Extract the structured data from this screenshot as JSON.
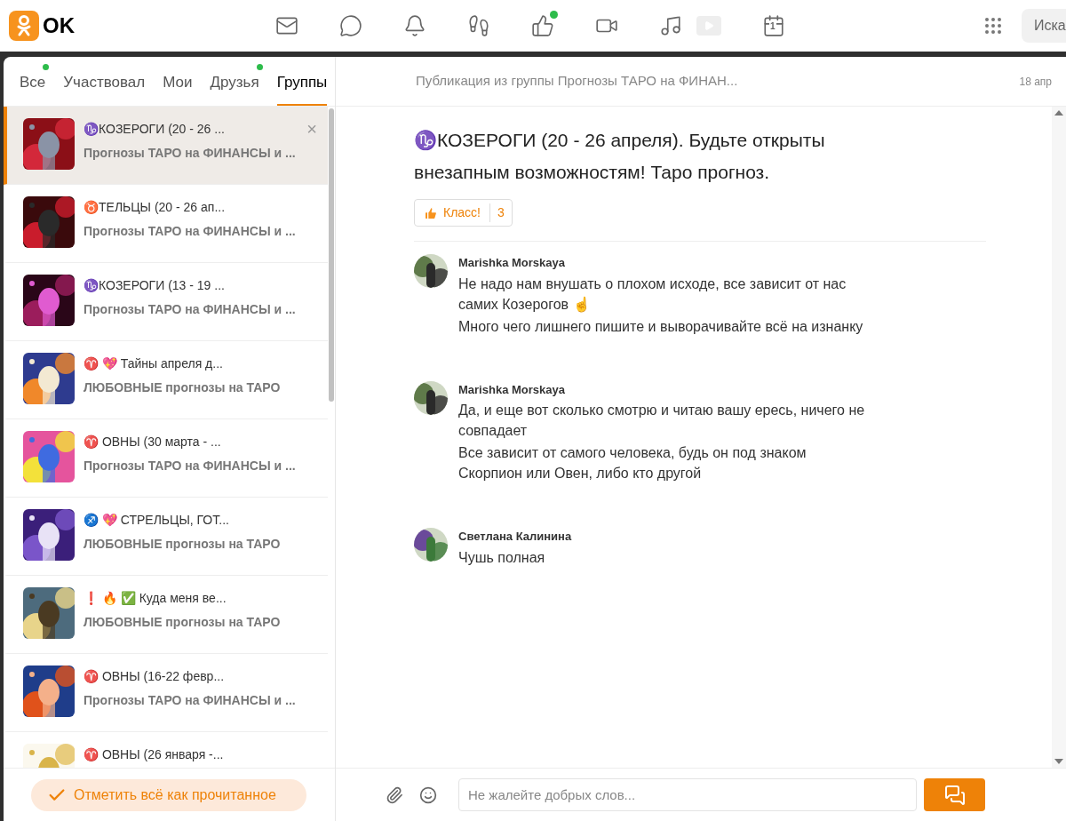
{
  "topbar": {
    "logo_text": "OK",
    "nav": [
      {
        "kind": "mail",
        "dot": false
      },
      {
        "kind": "chat",
        "dot": false
      },
      {
        "kind": "bell",
        "dot": false
      },
      {
        "kind": "steps",
        "dot": false
      },
      {
        "kind": "like",
        "dot": true
      },
      {
        "kind": "video",
        "dot": false
      },
      {
        "kind": "music",
        "dot": false
      },
      {
        "kind": "play",
        "dot": false
      },
      {
        "kind": "calendar",
        "dot": false,
        "label": "1"
      }
    ],
    "search": {
      "value": "Иска"
    }
  },
  "tabs": [
    {
      "label": "Все",
      "selected": false,
      "dot": true
    },
    {
      "label": "Участвовал",
      "selected": false,
      "dot": false
    },
    {
      "label": "Мои",
      "selected": false,
      "dot": false
    },
    {
      "label": "Друзья",
      "selected": false,
      "dot": true
    },
    {
      "label": "Группы",
      "selected": true,
      "dot": false
    }
  ],
  "discussions": [
    {
      "title": "♑КОЗЕРОГИ (20 - 26 ...",
      "group": "Прогнозы ТАРО на ФИНАНСЫ и ...",
      "selected": true,
      "close": "×"
    },
    {
      "title": "♉ТЕЛЬЦЫ (20 - 26 ап...",
      "group": "Прогнозы ТАРО на ФИНАНСЫ и ...",
      "selected": false
    },
    {
      "title": "♑КОЗЕРОГИ (13 - 19 ...",
      "group": "Прогнозы ТАРО на ФИНАНСЫ и ...",
      "selected": false
    },
    {
      "title": "♈ 💖 Тайны апреля д...",
      "group": "ЛЮБОВНЫЕ прогнозы на ТАРО",
      "selected": false
    },
    {
      "title": "♈ ОВНЫ (30 марта - ...",
      "group": "Прогнозы ТАРО на ФИНАНСЫ и ...",
      "selected": false
    },
    {
      "title": "♐ 💖 СТРЕЛЬЦЫ, ГОТ...",
      "group": "ЛЮБОВНЫЕ прогнозы на ТАРО",
      "selected": false
    },
    {
      "title": "❗ 🔥 ✅ Куда меня ве...",
      "group": "ЛЮБОВНЫЕ прогнозы на ТАРО",
      "selected": false
    },
    {
      "title": "♈ ОВНЫ (16-22 февр...",
      "group": "Прогнозы ТАРО на ФИНАНСЫ и ...",
      "selected": false
    },
    {
      "title": "♈ ОВНЫ (26 января -...",
      "selected": false
    }
  ],
  "mark_all_read": "Отметить всё как прочитанное",
  "topic": {
    "source": "Публикация из группы Прогнозы ТАРО на ФИНАН...",
    "date": "18 апр",
    "title": "♑КОЗЕРОГИ (20 - 26 апреля). Будьте открыты внезапным возможностям! Таро прогноз.",
    "like_label": "Класс!",
    "like_count": "3"
  },
  "comments": [
    {
      "author": "Marishka Morskaya",
      "lines": [
        "Не надо нам внушать о плохом исходе, все зависит от нас самих Козерогов ☝",
        "Много чего лишнего пишите и выворачивайте всё на изнанку"
      ]
    },
    {
      "author": "Marishka Morskaya",
      "lines": [
        "Да, и еще вот сколько смотрю и читаю вашу ересь, ничего не совпадает",
        "Все зависит от самого человека, будь он под знаком Скорпион или Овен, либо кто другой"
      ]
    },
    {
      "author": "Светлана Калинина",
      "lines": [
        "Чушь полная"
      ]
    }
  ],
  "composer": {
    "placeholder": "Не жалейте добрых слов..."
  }
}
